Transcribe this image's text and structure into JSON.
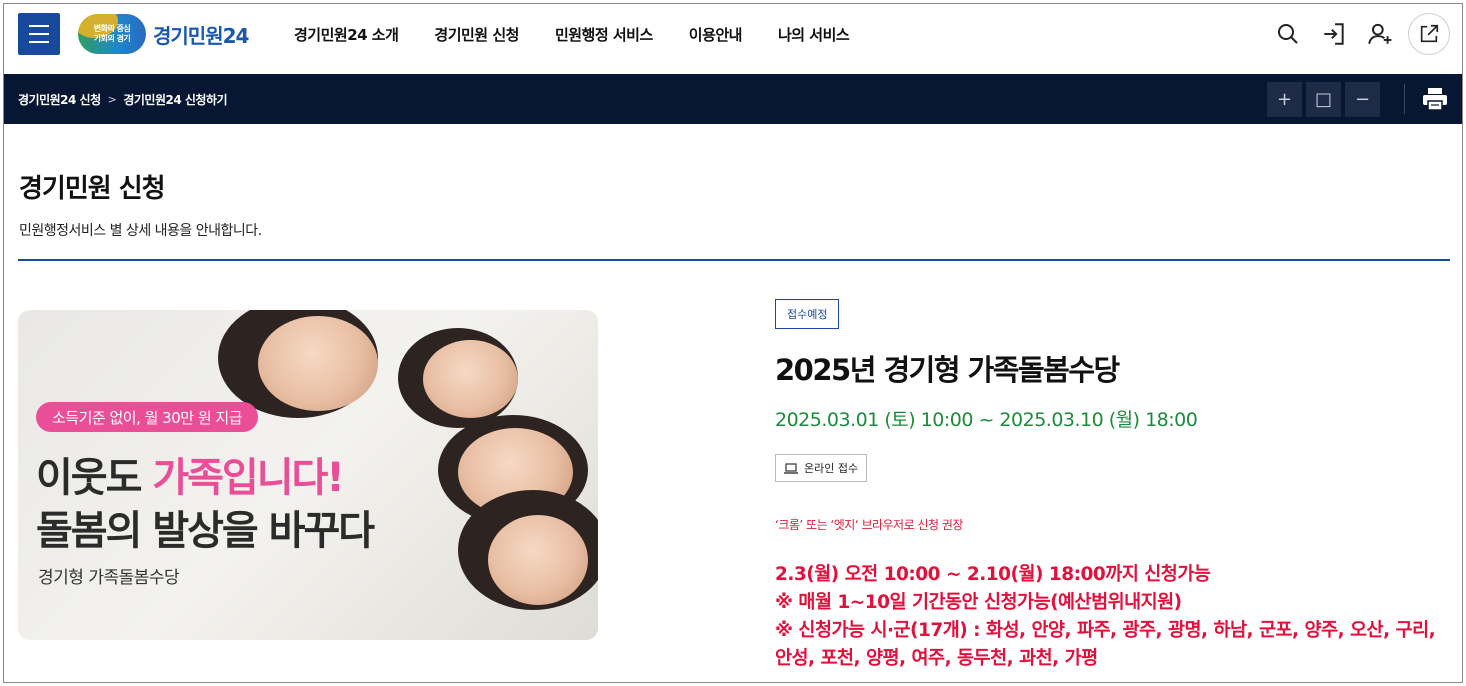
{
  "header": {
    "logo_badge_line1": "변화의 중심",
    "logo_badge_line2": "기회의 경기",
    "logo_text": "경기민원24",
    "nav": [
      "경기민원24 소개",
      "경기민원 신청",
      "민원행정 서비스",
      "이용안내",
      "나의 서비스"
    ],
    "icons": [
      "search-icon",
      "login-icon",
      "user-add-icon",
      "external-link-icon"
    ]
  },
  "breadcrumb": {
    "items": [
      "경기민원24 신청",
      "경기민원24 신청하기"
    ],
    "separator": ">",
    "zoom_buttons": [
      "+",
      "□",
      "−"
    ]
  },
  "page": {
    "title": "경기민원 신청",
    "subtitle": "민원행정서비스 별 상세 내용을 안내합니다."
  },
  "banner": {
    "pill": "소득기준 없이, 월 30만 원 지급",
    "line1_a": "이웃도 ",
    "line1_b": "가족입니다!",
    "line2": "돌봄의 발상을 바꾸다",
    "caption": "경기형 가족돌봄수당"
  },
  "service": {
    "status_tag": "접수예정",
    "title": "2025년 경기형 가족돌봄수당",
    "period": "2025.03.01 (토) 10:00 ~ 2025.03.10 (월) 18:00",
    "online_label": "온라인 접수",
    "browser_note": "‘크롬’ 또는 ‘엣지‘ 브라우저로 신청 권장",
    "notices": [
      "2.3(월) 오전 10:00 ~ 2.10(월) 18:00까지 신청가능",
      "※ 매월 1~10일 기간동안 신청가능(예산범위내지원)",
      "※ 신청가능 시·군(17개) : 화성, 안양, 파주, 광주, 광명, 하남, 군포, 양주, 오산, 구리, 안성, 포천, 양평, 여주, 동두천, 과천, 가평"
    ]
  },
  "colors": {
    "primary": "#174a9c",
    "breadcrumb_bg": "#071733",
    "green": "#1d8b3c",
    "red": "#e1113b",
    "pink": "#ea4e96"
  }
}
